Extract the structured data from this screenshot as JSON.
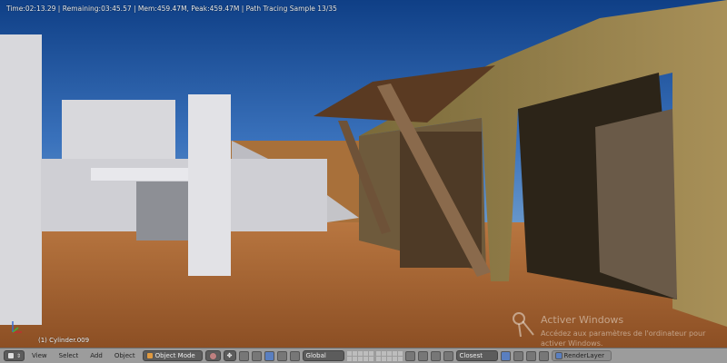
{
  "status": {
    "text": "Time:02:13.29 | Remaining:03:45.57 | Mem:459.47M, Peak:459.47M | Path Tracing Sample 13/35"
  },
  "viewport": {
    "object_label": "(1) Cylinder.009"
  },
  "watermark": {
    "title": "Activer Windows",
    "subtitle": "Accédez aux paramètres de l'ordinateur pour activer Windows."
  },
  "toolbar": {
    "menus": [
      "View",
      "Select",
      "Add",
      "Object"
    ],
    "mode": "Object Mode",
    "orientation": "Global",
    "snap_target": "Closest",
    "render_layer": "RenderLayer"
  },
  "colors": {
    "sky": "#2f5fa8",
    "sand": "#a5632f",
    "toolbar": "#9c9c9c"
  }
}
